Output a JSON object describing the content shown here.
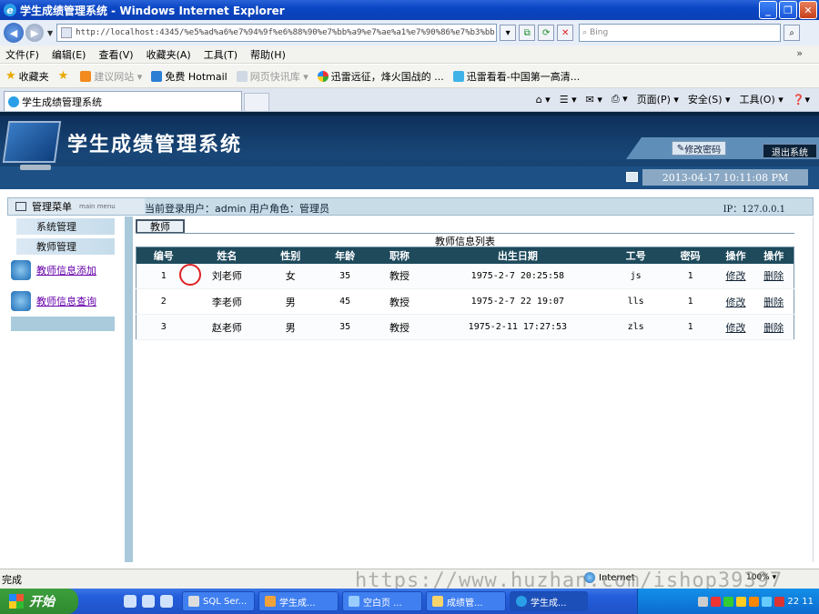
{
  "window": {
    "title": "学生成绩管理系统 - Windows Internet Explorer"
  },
  "browser": {
    "address": "http://localhost:4345/%e5%ad%a6%e7%94%9f%e6%88%90%e7%bb%a9%e7%ae%a1%e7%90%86%e7%b3%bb",
    "search_placeholder": "Bing",
    "menu": [
      "文件(F)",
      "编辑(E)",
      "查看(V)",
      "收藏夹(A)",
      "工具(T)",
      "帮助(H)"
    ],
    "favorites": {
      "label": "收藏夹",
      "items": [
        "建议网站 ▾",
        "免费 Hotmail",
        "网页快讯库 ▾",
        "迅雷远征，烽火国战的 ...",
        "迅雷看看-中国第一高清..."
      ]
    },
    "tab_title": "学生成绩管理系统",
    "tools": [
      "页面(P) ▾",
      "安全(S) ▾",
      "工具(O) ▾"
    ]
  },
  "app": {
    "system_title": "学生成绩管理系统",
    "change_password_label": "修改密码",
    "logout_label": "退出系统",
    "datetime": "2013-04-17 10:11:08 PM",
    "menu_header": "管理菜单",
    "menu_header_en": "main menu",
    "current_user": "当前登录用户：admin  用户角色：管理员",
    "ip": "IP：127.0.0.1",
    "sidebar": {
      "groups": [
        "系统管理",
        "教师管理"
      ],
      "links": [
        "教师信息添加",
        "教师信息查询"
      ]
    },
    "tab_label": "教师",
    "table_caption": "教师信息列表",
    "columns": [
      "编号",
      "姓名",
      "性别",
      "年龄",
      "职称",
      "出生日期",
      "工号",
      "密码",
      "操作",
      "操作"
    ],
    "rows": [
      {
        "id": "1",
        "name": "刘老师",
        "gender": "女",
        "age": "35",
        "title": "教授",
        "birth": "1975-2-7 20:25:58",
        "code": "js",
        "pwd": "1",
        "edit": "修改",
        "delete": "删除"
      },
      {
        "id": "2",
        "name": "李老师",
        "gender": "男",
        "age": "45",
        "title": "教授",
        "birth": "1975-2-7 22 19:07",
        "code": "lls",
        "pwd": "1",
        "edit": "修改",
        "delete": "删除"
      },
      {
        "id": "3",
        "name": "赵老师",
        "gender": "男",
        "age": "35",
        "title": "教授",
        "birth": "1975-2-11 17:27:53",
        "code": "zls",
        "pwd": "1",
        "edit": "修改",
        "delete": "删除"
      }
    ]
  },
  "status": {
    "text": "完成",
    "zone": "Internet",
    "zoom": "100%",
    "watermark": "https://www.huzhan.com/ishop39397"
  },
  "taskbar": {
    "start": "开始",
    "tasks": [
      "SQL Ser...",
      "学生成...",
      "空白页 ...",
      "成绩管...",
      "学生成..."
    ],
    "clock": "22 11"
  }
}
